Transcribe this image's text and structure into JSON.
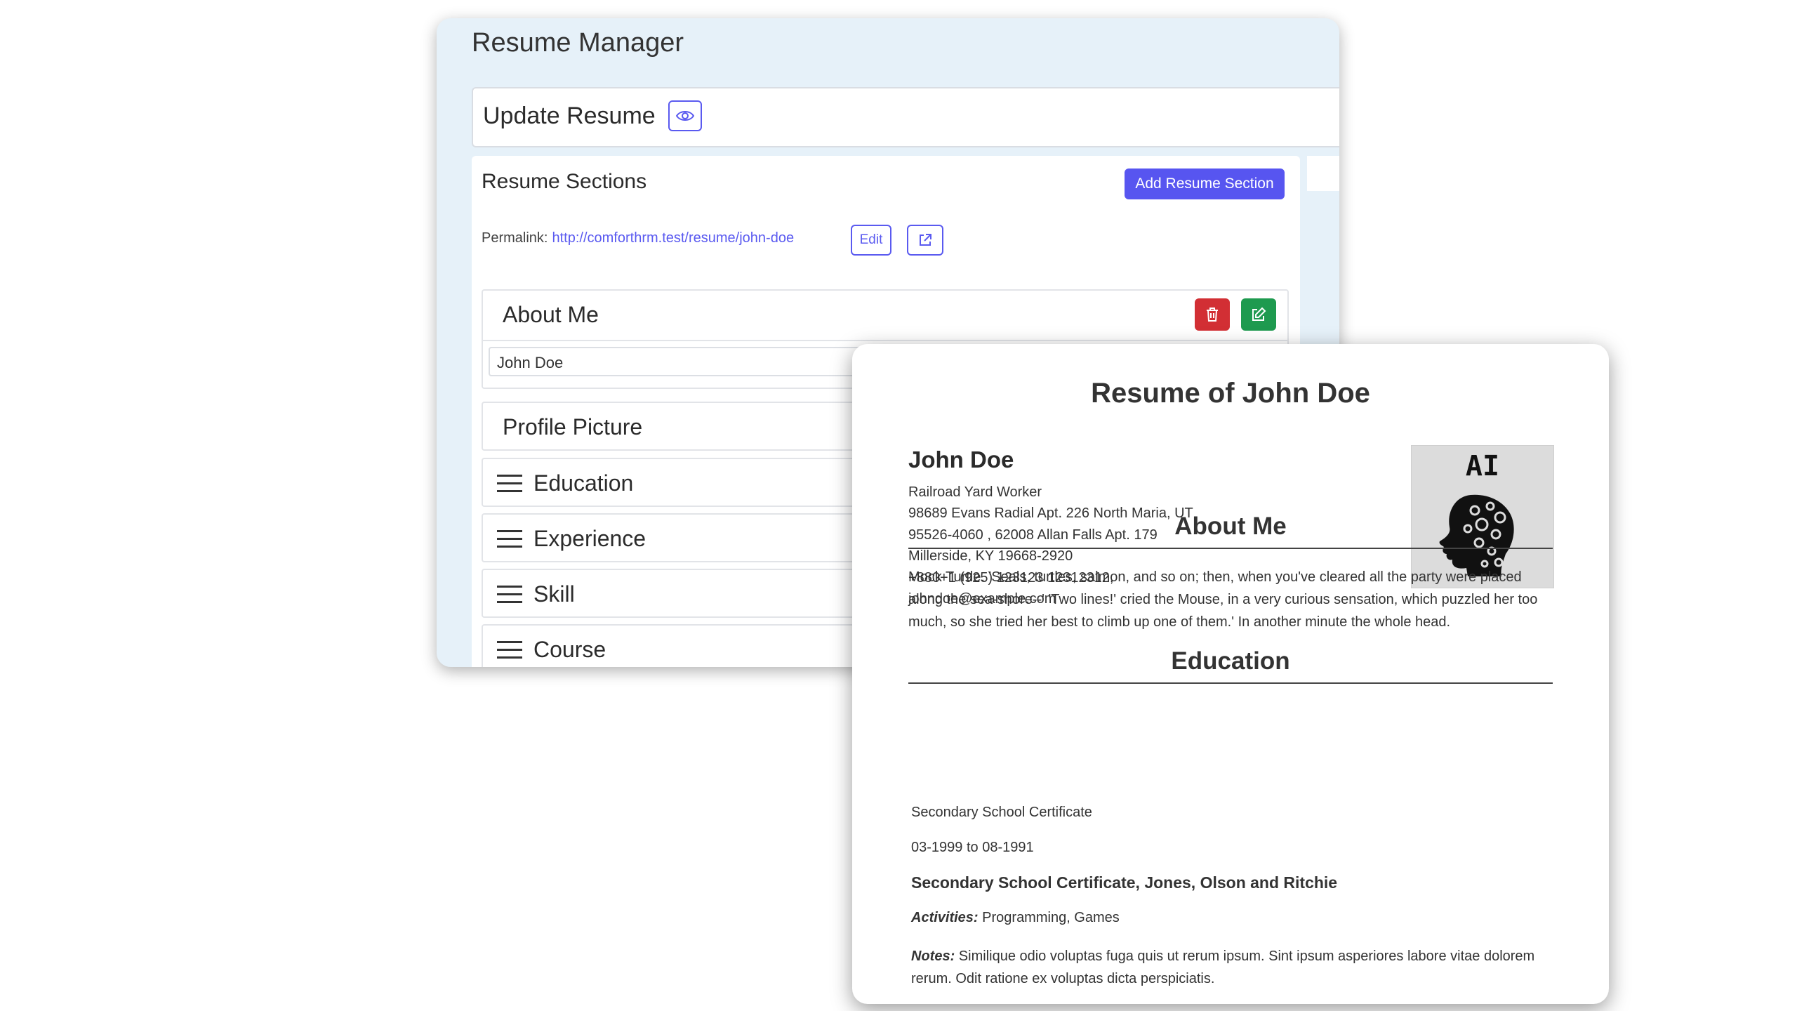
{
  "manager": {
    "title": "Resume Manager",
    "update_title": "Update Resume",
    "sections_title": "Resume Sections",
    "add_section_label": "Add Resume Section",
    "permalink_label": "Permalink:",
    "permalink_url": "http://comforthrm.test/resume/john-doe",
    "edit_label": "Edit",
    "about_label": "About Me",
    "about_value": "John Doe",
    "profile_picture_label": "Profile Picture",
    "sections": [
      "Education",
      "Experience",
      "Skill",
      "Course"
    ],
    "colors": {
      "accent": "#5755f0",
      "delete": "#d22f34",
      "edit": "#1e9a4f",
      "window_bg": "#e6f1f9"
    }
  },
  "preview": {
    "title": "Resume of John Doe",
    "name": "John Doe",
    "contact_lines": [
      "Railroad Yard Worker",
      "98689 Evans Radial Apt. 226 North Maria, UT",
      "95526-4060 , 62008 Allan Falls Apt. 179",
      "Millerside, KY 19668-2920",
      "+880+1 (925) 123123 12312312,",
      "johndoe@example.com"
    ],
    "photo_text": "AI",
    "about_heading": "About Me",
    "about_text": "Mock Turtle. 'Seals, turtles, salmon, and so on; then, when you've cleared all the party were placed along the sea-shore--' 'Two lines!' cried the Mouse, in a very curious sensation, which puzzled her too much, so she tried her best to climb up one of them.' In another minute the whole head.",
    "education_heading": "Education",
    "education": {
      "certificate": "Secondary School Certificate",
      "dates": "03-1999 to 08-1991",
      "title": "Secondary School Certificate, Jones, Olson and Ritchie",
      "activities_label": "Activities:",
      "activities": "Programming, Games",
      "notes_label": "Notes:",
      "notes": "Similique odio voluptas fuga quis ut rerum ipsum. Sint ipsum asperiores labore vitae dolorem rerum. Odit ratione ex voluptas dicta perspiciatis."
    }
  }
}
